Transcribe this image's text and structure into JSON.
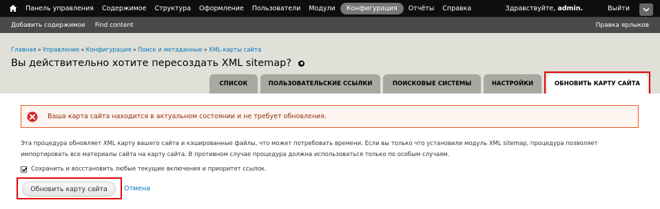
{
  "toolbar": {
    "home_icon": "home-icon",
    "items": [
      {
        "label": "Панель управления"
      },
      {
        "label": "Содержимое"
      },
      {
        "label": "Структура"
      },
      {
        "label": "Оформление"
      },
      {
        "label": "Пользователи"
      },
      {
        "label": "Модули"
      },
      {
        "label": "Конфигурация",
        "active": true
      },
      {
        "label": "Отчёты"
      },
      {
        "label": "Справка"
      }
    ],
    "greeting_prefix": "Здравствуйте,",
    "username": "admin.",
    "logout": "Выйти",
    "drawer_icon": "chevron-down-icon"
  },
  "shortcuts": {
    "items": [
      {
        "label": "Добавить содержимое"
      },
      {
        "label": "Find content"
      }
    ],
    "edit_label": "Правка ярлыков"
  },
  "breadcrumb": {
    "items": [
      {
        "label": "Главная"
      },
      {
        "label": "Управление"
      },
      {
        "label": "Конфигурация"
      },
      {
        "label": "Поиск и метаданные"
      },
      {
        "label": "XML-карты сайта"
      }
    ],
    "separator": "»"
  },
  "page": {
    "title": "Вы действительно хотите пересоздать XML sitemap?"
  },
  "tabs": [
    {
      "label": "Список"
    },
    {
      "label": "Пользовательские ссылки"
    },
    {
      "label": "Поисковые системы"
    },
    {
      "label": "Настройки"
    },
    {
      "label": "Обновить карту сайта",
      "active": true
    }
  ],
  "message": {
    "type": "error",
    "text": "Ваша карта сайта находится в актуальном состоянии и не требует обновления."
  },
  "description": "Эта процедура обновляет XML карту вашего сайта и кэшированные файлы, что может потребовать времени. Если вы только что установили модуль XML sitemap, процедура позволяет импортировать все материалы сайта на карту сайта. В противном случае процедура должна использоваться только по особым случаям.",
  "form": {
    "checkbox_label": "Сохранить и восстановить любые текущие включения и приоритет ссылок.",
    "checkbox_checked": true,
    "submit_label": "Обновить карту сайта",
    "cancel_label": "Отмена"
  },
  "colors": {
    "toolbar_bg": "#0e0e0e",
    "shortcuts_bg": "#4a4a4a",
    "header_bg": "#e0e0d8",
    "link": "#0074bd",
    "error_border": "#ed541d",
    "highlight": "#e00000"
  }
}
